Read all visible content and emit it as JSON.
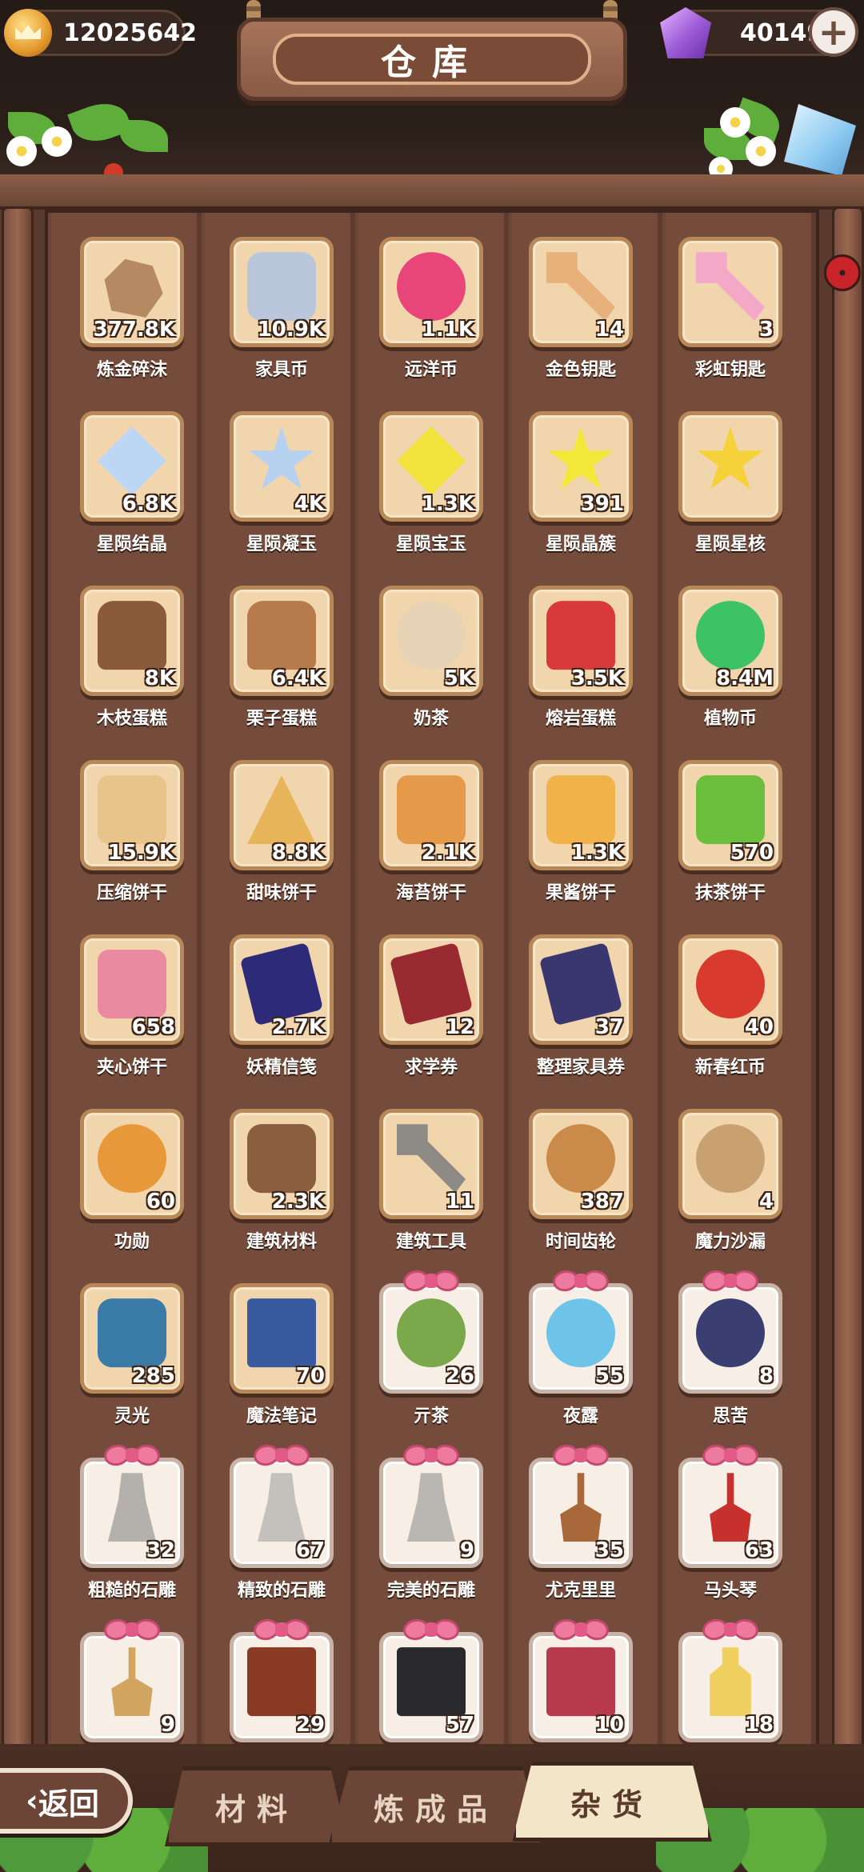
{
  "header": {
    "title": "仓库",
    "coins": "12025642",
    "gems": "40149"
  },
  "items": [
    {
      "name": "炼金碎沫",
      "qty": "377.8K",
      "shape": "s-rock",
      "color": "#b58a62",
      "icon": "rubble-icon",
      "gift": false
    },
    {
      "name": "家具币",
      "qty": "10.9K",
      "shape": "s-square",
      "color": "#b9c6dc",
      "icon": "furniture-coin-icon",
      "gift": false
    },
    {
      "name": "远洋币",
      "qty": "1.1K",
      "shape": "s-coin",
      "color": "#e8467a",
      "icon": "ocean-coin-icon",
      "gift": false
    },
    {
      "name": "金色钥匙",
      "qty": "14",
      "shape": "s-key",
      "color": "#e8b07a",
      "icon": "golden-key-icon",
      "gift": false
    },
    {
      "name": "彩虹钥匙",
      "qty": "3",
      "shape": "s-key",
      "color": "#f4a8c8",
      "icon": "rainbow-key-icon",
      "gift": false
    },
    {
      "name": "星陨结晶",
      "qty": "6.8K",
      "shape": "s-diamond",
      "color": "#bcd6f4",
      "icon": "crystal-icon",
      "gift": false
    },
    {
      "name": "星陨凝玉",
      "qty": "4K",
      "shape": "s-star",
      "color": "#b6d2f0",
      "icon": "jade-star-icon",
      "gift": false
    },
    {
      "name": "星陨宝玉",
      "qty": "1.3K",
      "shape": "s-diamond",
      "color": "#f1e23c",
      "icon": "gem-icon",
      "gift": false
    },
    {
      "name": "星陨晶簇",
      "qty": "391",
      "shape": "s-star",
      "color": "#f3e83a",
      "icon": "crystal-cluster-icon",
      "gift": false
    },
    {
      "name": "星陨星核",
      "qty": "",
      "shape": "s-star",
      "color": "#f6d23a",
      "icon": "star-core-icon",
      "gift": false
    },
    {
      "name": "木枝蛋糕",
      "qty": "8K",
      "shape": "s-cake",
      "color": "#8a5a3a",
      "icon": "log-cake-icon",
      "gift": false
    },
    {
      "name": "栗子蛋糕",
      "qty": "6.4K",
      "shape": "s-cake",
      "color": "#b77a4a",
      "icon": "chestnut-cake-icon",
      "gift": false
    },
    {
      "name": "奶茶",
      "qty": "5K",
      "shape": "s-cup",
      "color": "#e6d2b4",
      "icon": "milk-tea-icon",
      "gift": false
    },
    {
      "name": "熔岩蛋糕",
      "qty": "3.5K",
      "shape": "s-cake",
      "color": "#d83a3a",
      "icon": "lava-cake-icon",
      "gift": false
    },
    {
      "name": "植物币",
      "qty": "8.4M",
      "shape": "s-coin",
      "color": "#3ec266",
      "icon": "plant-coin-icon",
      "gift": false
    },
    {
      "name": "压缩饼干",
      "qty": "15.9K",
      "shape": "s-cookie",
      "color": "#e9c48a",
      "icon": "cracker-icon",
      "gift": false
    },
    {
      "name": "甜味饼干",
      "qty": "8.8K",
      "shape": "s-tri",
      "color": "#e8b45a",
      "icon": "sweet-cracker-icon",
      "gift": false
    },
    {
      "name": "海苔饼干",
      "qty": "2.1K",
      "shape": "s-cookie",
      "color": "#e59a4a",
      "icon": "seaweed-cracker-icon",
      "gift": false
    },
    {
      "name": "果酱饼干",
      "qty": "1.3K",
      "shape": "s-cookie",
      "color": "#f2b24a",
      "icon": "jam-cookie-icon",
      "gift": false
    },
    {
      "name": "抹茶饼干",
      "qty": "570",
      "shape": "s-cookie",
      "color": "#6cbf3c",
      "icon": "matcha-cookie-icon",
      "gift": false
    },
    {
      "name": "夹心饼干",
      "qty": "658",
      "shape": "s-cookie",
      "color": "#e98aa0",
      "icon": "sandwich-cookie-icon",
      "gift": false
    },
    {
      "name": "妖精信笺",
      "qty": "2.7K",
      "shape": "s-ticket",
      "color": "#2e2a7a",
      "icon": "fairy-letter-icon",
      "gift": false
    },
    {
      "name": "求学券",
      "qty": "12",
      "shape": "s-ticket",
      "color": "#9a2a32",
      "icon": "study-ticket-icon",
      "gift": false
    },
    {
      "name": "整理家具券",
      "qty": "37",
      "shape": "s-ticket",
      "color": "#3a3670",
      "icon": "furniture-ticket-icon",
      "gift": false
    },
    {
      "name": "新春红币",
      "qty": "40",
      "shape": "s-coin",
      "color": "#d83a2e",
      "icon": "red-coin-icon",
      "gift": false
    },
    {
      "name": "功勋",
      "qty": "60",
      "shape": "s-coin",
      "color": "#e89a3a",
      "icon": "medal-icon",
      "gift": false
    },
    {
      "name": "建筑材料",
      "qty": "2.3K",
      "shape": "s-square",
      "color": "#8a5e3e",
      "icon": "building-material-icon",
      "gift": false
    },
    {
      "name": "建筑工具",
      "qty": "11",
      "shape": "s-key",
      "color": "#8e8a86",
      "icon": "hammer-icon",
      "gift": false
    },
    {
      "name": "时间齿轮",
      "qty": "387",
      "shape": "s-gear",
      "color": "#c98a4a",
      "icon": "gear-icon",
      "gift": false
    },
    {
      "name": "魔力沙漏",
      "qty": "4",
      "shape": "s-coin",
      "color": "#c9a070",
      "icon": "hourglass-icon",
      "gift": false
    },
    {
      "name": "灵光",
      "qty": "285",
      "shape": "s-square",
      "color": "#3a7aa6",
      "icon": "spark-icon",
      "gift": false
    },
    {
      "name": "魔法笔记",
      "qty": "70",
      "shape": "s-book",
      "color": "#3a5aa0",
      "icon": "notebook-icon",
      "gift": false
    },
    {
      "name": "亓茶",
      "qty": "26",
      "shape": "s-cup",
      "color": "#7aa84a",
      "icon": "tea-bowl-icon",
      "gift": true
    },
    {
      "name": "夜露",
      "qty": "55",
      "shape": "s-cup",
      "color": "#6ec4e8",
      "icon": "dew-bowl-icon",
      "gift": true
    },
    {
      "name": "思苦",
      "qty": "8",
      "shape": "s-cup",
      "color": "#3a3e70",
      "icon": "cup-icon",
      "gift": true
    },
    {
      "name": "粗糙的石雕",
      "qty": "32",
      "shape": "s-statue",
      "color": "#b4b0ac",
      "icon": "rough-statue-icon",
      "gift": true
    },
    {
      "name": "精致的石雕",
      "qty": "67",
      "shape": "s-statue",
      "color": "#c4c0bc",
      "icon": "fine-statue-icon",
      "gift": true
    },
    {
      "name": "完美的石雕",
      "qty": "9",
      "shape": "s-statue",
      "color": "#bab6b2",
      "icon": "perfect-statue-icon",
      "gift": true
    },
    {
      "name": "尤克里里",
      "qty": "35",
      "shape": "s-guitar",
      "color": "#a8683a",
      "icon": "ukulele-icon",
      "gift": true
    },
    {
      "name": "马头琴",
      "qty": "63",
      "shape": "s-guitar",
      "color": "#c8302e",
      "icon": "morin-khuur-icon",
      "gift": true
    },
    {
      "name": "",
      "qty": "9",
      "shape": "s-guitar",
      "color": "#d2a660",
      "icon": "lute-icon",
      "gift": true
    },
    {
      "name": "",
      "qty": "29",
      "shape": "s-book",
      "color": "#8a3a22",
      "icon": "brown-book-icon",
      "gift": true
    },
    {
      "name": "",
      "qty": "57",
      "shape": "s-book",
      "color": "#2a2a2e",
      "icon": "black-book-icon",
      "gift": true
    },
    {
      "name": "",
      "qty": "10",
      "shape": "s-book",
      "color": "#b83a4a",
      "icon": "red-book-icon",
      "gift": true
    },
    {
      "name": "",
      "qty": "18",
      "shape": "s-bottle",
      "color": "#f0d060",
      "icon": "bottle-icon",
      "gift": true
    }
  ],
  "bottom": {
    "back_label": "返回",
    "tabs": [
      {
        "label": "材料",
        "active": false
      },
      {
        "label": "炼成品",
        "active": false
      },
      {
        "label": "杂货",
        "active": true
      }
    ]
  }
}
